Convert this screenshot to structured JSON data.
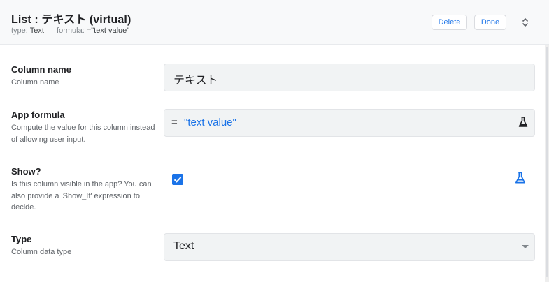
{
  "header": {
    "title": "List : テキスト (virtual)",
    "type_label": "type:",
    "type_value": "Text",
    "formula_label": "formula:",
    "formula_value": "=\"text value\"",
    "delete_label": "Delete",
    "done_label": "Done",
    "expand_icon": "unfold-icon"
  },
  "fields": {
    "column_name": {
      "label": "Column name",
      "description": "Column name",
      "value": "テキスト"
    },
    "app_formula": {
      "label": "App formula",
      "description": "Compute the value for this column instead of allowing user input.",
      "equals": "=",
      "value": "\"text value\"",
      "icon": "flask-icon"
    },
    "show": {
      "label": "Show?",
      "description": "Is this column visible in the app? You can also provide a 'Show_If' expression to decide.",
      "checked": true,
      "icon": "flask-icon"
    },
    "type": {
      "label": "Type",
      "description": "Column data type",
      "value": "Text"
    }
  },
  "colors": {
    "accent": "#1a73e8",
    "field_bg": "#f1f3f4",
    "header_bg": "#f8f9fa"
  }
}
